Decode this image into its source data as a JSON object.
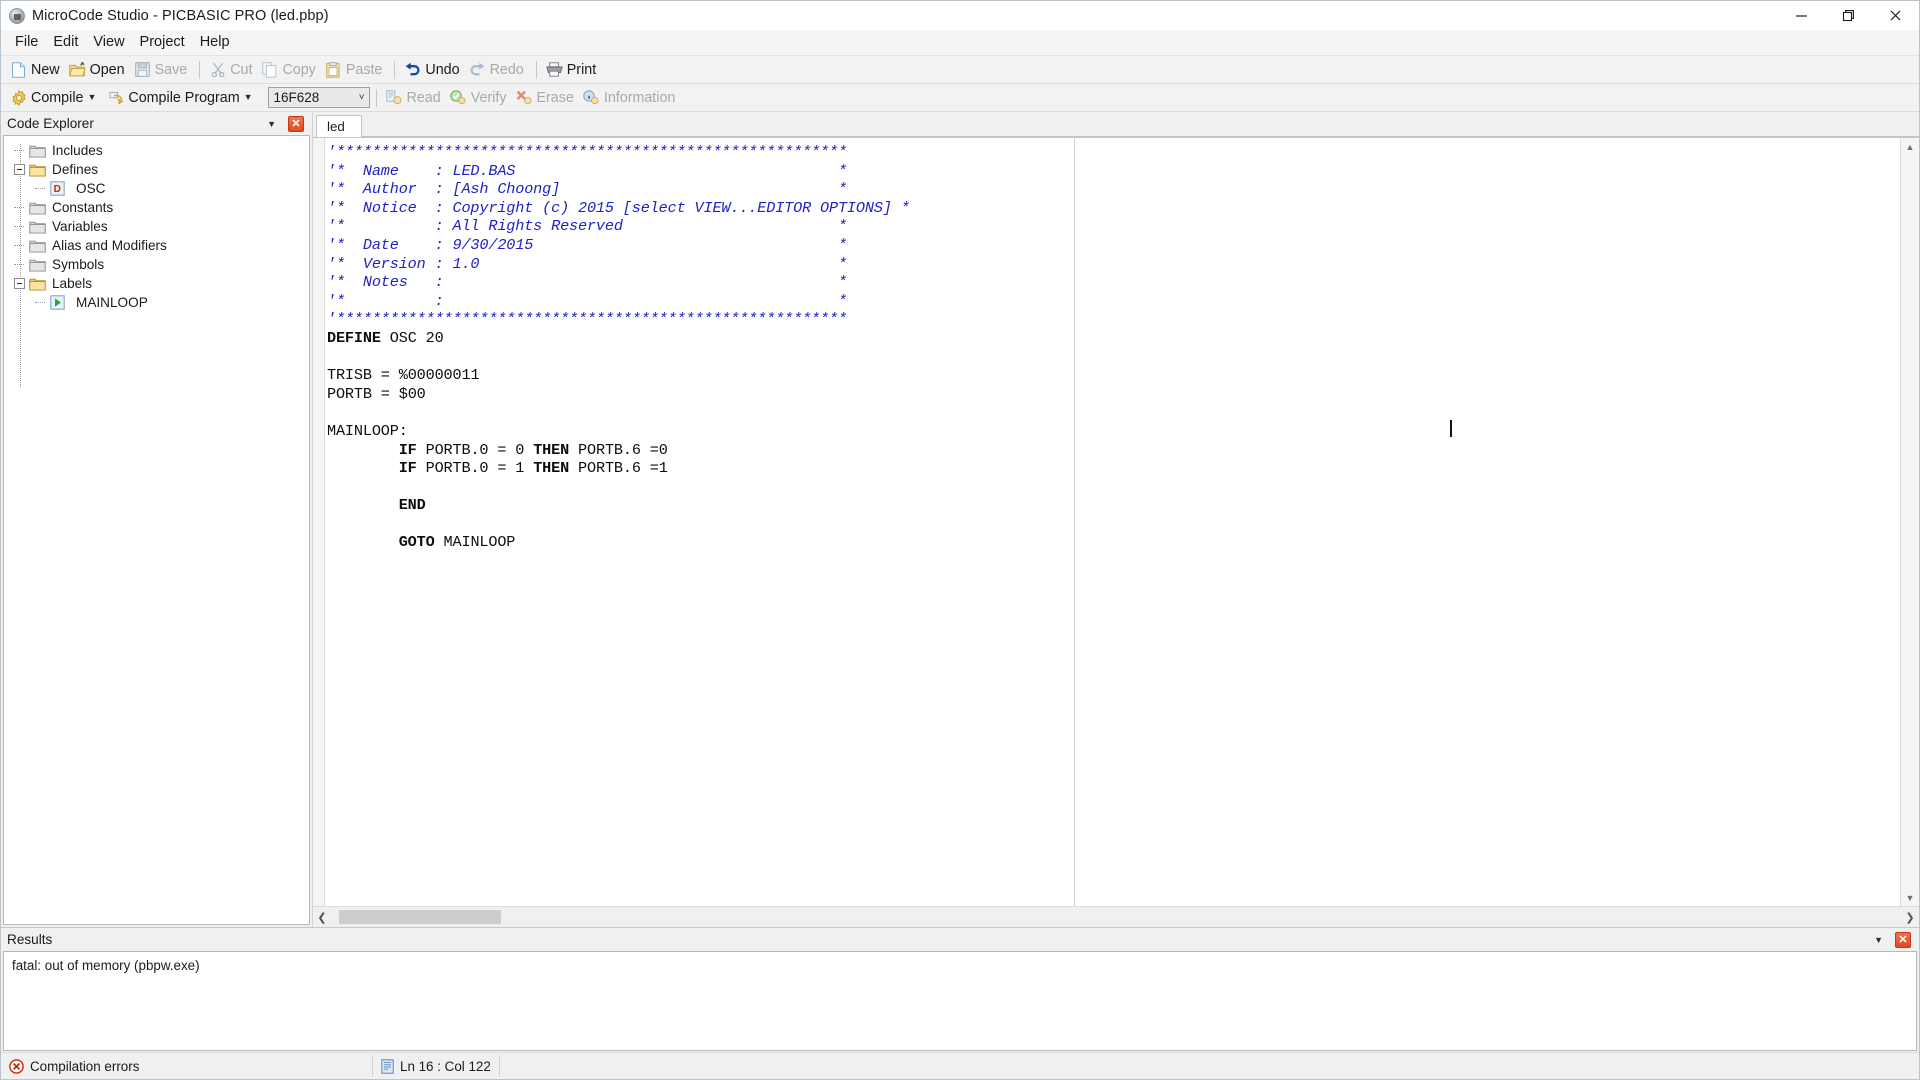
{
  "window": {
    "title": "MicroCode Studio - PICBASIC PRO (led.pbp)",
    "app_icon": "app-icon",
    "controls": {
      "minimize": "minimize-icon",
      "maximize": "maximize-icon",
      "close": "close-icon"
    }
  },
  "menubar": {
    "items": [
      {
        "label": "File"
      },
      {
        "label": "Edit"
      },
      {
        "label": "View"
      },
      {
        "label": "Project"
      },
      {
        "label": "Help"
      }
    ]
  },
  "toolbar_main": {
    "buttons": [
      {
        "label": "New",
        "icon": "new-file-icon",
        "enabled": true
      },
      {
        "label": "Open",
        "icon": "open-folder-icon",
        "enabled": true
      },
      {
        "label": "Save",
        "icon": "save-disk-icon",
        "enabled": false
      },
      {
        "label": "Cut",
        "icon": "scissors-icon",
        "enabled": false
      },
      {
        "label": "Copy",
        "icon": "copy-icon",
        "enabled": false
      },
      {
        "label": "Paste",
        "icon": "clipboard-paste-icon",
        "enabled": false
      },
      {
        "label": "Undo",
        "icon": "undo-arrow-icon",
        "enabled": true
      },
      {
        "label": "Redo",
        "icon": "redo-arrow-icon",
        "enabled": false
      },
      {
        "label": "Print",
        "icon": "printer-icon",
        "enabled": true
      }
    ]
  },
  "toolbar_compile": {
    "compile_label": "Compile",
    "compile_icon": "compile-gear-icon",
    "compile_program_label": "Compile Program",
    "compile_program_icon": "compile-program-icon",
    "device_value": "16F628",
    "device_dropdown_icon": "chevron-down-icon",
    "buttons": [
      {
        "label": "Read",
        "icon": "read-icon",
        "enabled": false
      },
      {
        "label": "Verify",
        "icon": "verify-check-icon",
        "enabled": false
      },
      {
        "label": "Erase",
        "icon": "erase-x-icon",
        "enabled": false
      },
      {
        "label": "Information",
        "icon": "information-icon",
        "enabled": false
      }
    ]
  },
  "code_explorer": {
    "title": "Code Explorer",
    "menu_icon": "chevron-down-icon",
    "close_icon": "close-icon",
    "tree": [
      {
        "label": "Includes",
        "icon": "folder-icon",
        "expander": "none",
        "level": 0
      },
      {
        "label": "Defines",
        "icon": "folder-open-icon",
        "expander": "collapse",
        "level": 0
      },
      {
        "label": "OSC",
        "icon": "define-icon",
        "expander": "none",
        "level": 1
      },
      {
        "label": "Constants",
        "icon": "folder-icon",
        "expander": "none",
        "level": 0
      },
      {
        "label": "Variables",
        "icon": "folder-icon",
        "expander": "none",
        "level": 0
      },
      {
        "label": "Alias and Modifiers",
        "icon": "folder-icon",
        "expander": "none",
        "level": 0
      },
      {
        "label": "Symbols",
        "icon": "folder-icon",
        "expander": "none",
        "level": 0
      },
      {
        "label": "Labels",
        "icon": "folder-open-icon",
        "expander": "collapse",
        "level": 0
      },
      {
        "label": "MAINLOOP",
        "icon": "label-play-icon",
        "expander": "none",
        "level": 1
      }
    ]
  },
  "editor": {
    "tabs": [
      {
        "label": "led",
        "active": true
      }
    ],
    "scroll_left_icon": "chevron-left-icon",
    "scroll_right_icon": "chevron-right-icon",
    "code_lines": [
      {
        "t": "comment",
        "text": "'*********************************************************"
      },
      {
        "t": "comment",
        "text": "'*  Name    : LED.BAS                                    *"
      },
      {
        "t": "comment",
        "text": "'*  Author  : [Ash Choong]                               *"
      },
      {
        "t": "comment",
        "text": "'*  Notice  : Copyright (c) 2015 [select VIEW...EDITOR OPTIONS] *"
      },
      {
        "t": "comment",
        "text": "'*          : All Rights Reserved                        *"
      },
      {
        "t": "comment",
        "text": "'*  Date    : 9/30/2015                                  *"
      },
      {
        "t": "comment",
        "text": "'*  Version : 1.0                                        *"
      },
      {
        "t": "comment",
        "text": "'*  Notes   :                                            *"
      },
      {
        "t": "comment",
        "text": "'*          :                                            *"
      },
      {
        "t": "comment",
        "text": "'*********************************************************"
      },
      {
        "t": "mixed",
        "kw": "DEFINE",
        "text": " OSC 20"
      },
      {
        "t": "blank",
        "text": ""
      },
      {
        "t": "code",
        "text": "TRISB = %00000011"
      },
      {
        "t": "code",
        "text": "PORTB = $00"
      },
      {
        "t": "blank",
        "text": ""
      },
      {
        "t": "code",
        "text": "MAINLOOP:"
      },
      {
        "t": "if",
        "text": "        IF PORTB.0 = 0 THEN PORTB.6 =0"
      },
      {
        "t": "if",
        "text": "        IF PORTB.0 = 1 THEN PORTB.6 =1"
      },
      {
        "t": "blank",
        "text": ""
      },
      {
        "t": "bold",
        "text": "        END"
      },
      {
        "t": "blank",
        "text": ""
      },
      {
        "t": "bold",
        "text": "        GOTO MAINLOOP"
      }
    ]
  },
  "results": {
    "title": "Results",
    "menu_icon": "chevron-down-icon",
    "close_icon": "close-icon",
    "lines": [
      "fatal: out of memory (pbpw.exe)"
    ]
  },
  "statusbar": {
    "compile_status": "Compilation errors",
    "compile_status_icon": "error-x-icon",
    "cursor_position": "Ln 16 : Col 122",
    "cursor_icon": "document-lines-icon"
  },
  "colors": {
    "comment_blue": "#2121c8",
    "code_black": "#0d0d0d",
    "error_red": "#cc2200",
    "close_orange": "#e04a28",
    "chrome_gray": "#f0f0f0",
    "folder_gray": "#c9c9c9",
    "folder_open_yellow": "#f0c96a"
  }
}
